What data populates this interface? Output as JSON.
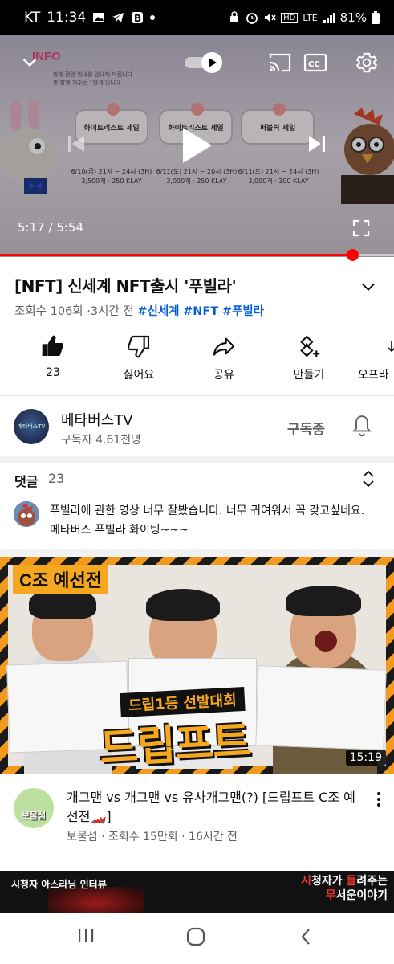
{
  "status_bar": {
    "carrier": "KT",
    "time": "11:34",
    "signal": "LTE",
    "battery": "81%"
  },
  "player": {
    "current_time": "5:17",
    "duration": "5:54",
    "separator": "/",
    "progress": 0.895,
    "frame": {
      "info_tag": "INFO",
      "info_line1": "판매 관련 안내를 안내해 드립니다.",
      "info_line2": "총 발행 개수는 1만개 입니다.",
      "cards": [
        {
          "title": "화이트리스트 세일",
          "line1": "6/10(금) 21시 ~ 24시 (3H)",
          "line2": "3,500개 · 250 KLAY"
        },
        {
          "title": "화이트리스트 세일",
          "line1": "6/11(토) 21시 ~ 20시 (3H)",
          "line2": "3,000개 · 250 KLAY"
        },
        {
          "title": "퍼블릭 세일",
          "line1": "6/11(토) 21시 ~ 24시 (3H)",
          "line2": "3,000개 · 300 KLAY"
        }
      ]
    }
  },
  "video": {
    "title": "[NFT] 신세계 NFT출시 '푸빌라'",
    "views": "조회수 106회",
    "age": "3시간 전",
    "separator": "·",
    "hashtags": [
      "#신세계",
      "#NFT",
      "#푸빌라"
    ]
  },
  "actions": [
    {
      "label": "23",
      "icon": "thumbs-up-filled-icon"
    },
    {
      "label": "싫어요",
      "icon": "thumbs-down-icon"
    },
    {
      "label": "공유",
      "icon": "share-icon"
    },
    {
      "label": "만들기",
      "icon": "remix-icon"
    },
    {
      "label": "오프라",
      "icon": "download-icon"
    }
  ],
  "channel": {
    "name": "메타버스TV",
    "subscribers": "구독자 4.61천명",
    "avatar_text": "메타버스TV",
    "subscribe_label": "구독중"
  },
  "comments": {
    "title": "댓글",
    "count": "23",
    "top_comment": "푸빌라에 관한 영상 너무 잘봤습니다. 너무 귀여워서 꼭 갖고싶네요. 메타버스 푸빌라 화이팅~~~"
  },
  "recommended": {
    "group_label": "C조 예선전",
    "event_banner": "드립1등 선발대회",
    "event_title": "드립프트",
    "duration": "15:19",
    "title": "개그맨 vs 개그맨 vs 유사개그맨(?) [드립프트 C조 예선전🏎️]",
    "channel": "보물섬",
    "views": "조회수 15만회",
    "age": "16시간 전",
    "separator": "·",
    "avatar_text": "보물섬"
  },
  "next_video": {
    "left_text": "시청자 아스라님 인터뷰",
    "right_line1_red": "시",
    "right_line1_a": "청자가 ",
    "right_line1_red2": "들",
    "right_line1_b": "려주는",
    "right_line2_red": "무",
    "right_line2_a": "서운이야기"
  },
  "colors": {
    "accent_red": "#ff0000",
    "link_blue": "#065fd4",
    "secondary_text": "#606060",
    "thumbnail_orange": "#f5a81f"
  }
}
